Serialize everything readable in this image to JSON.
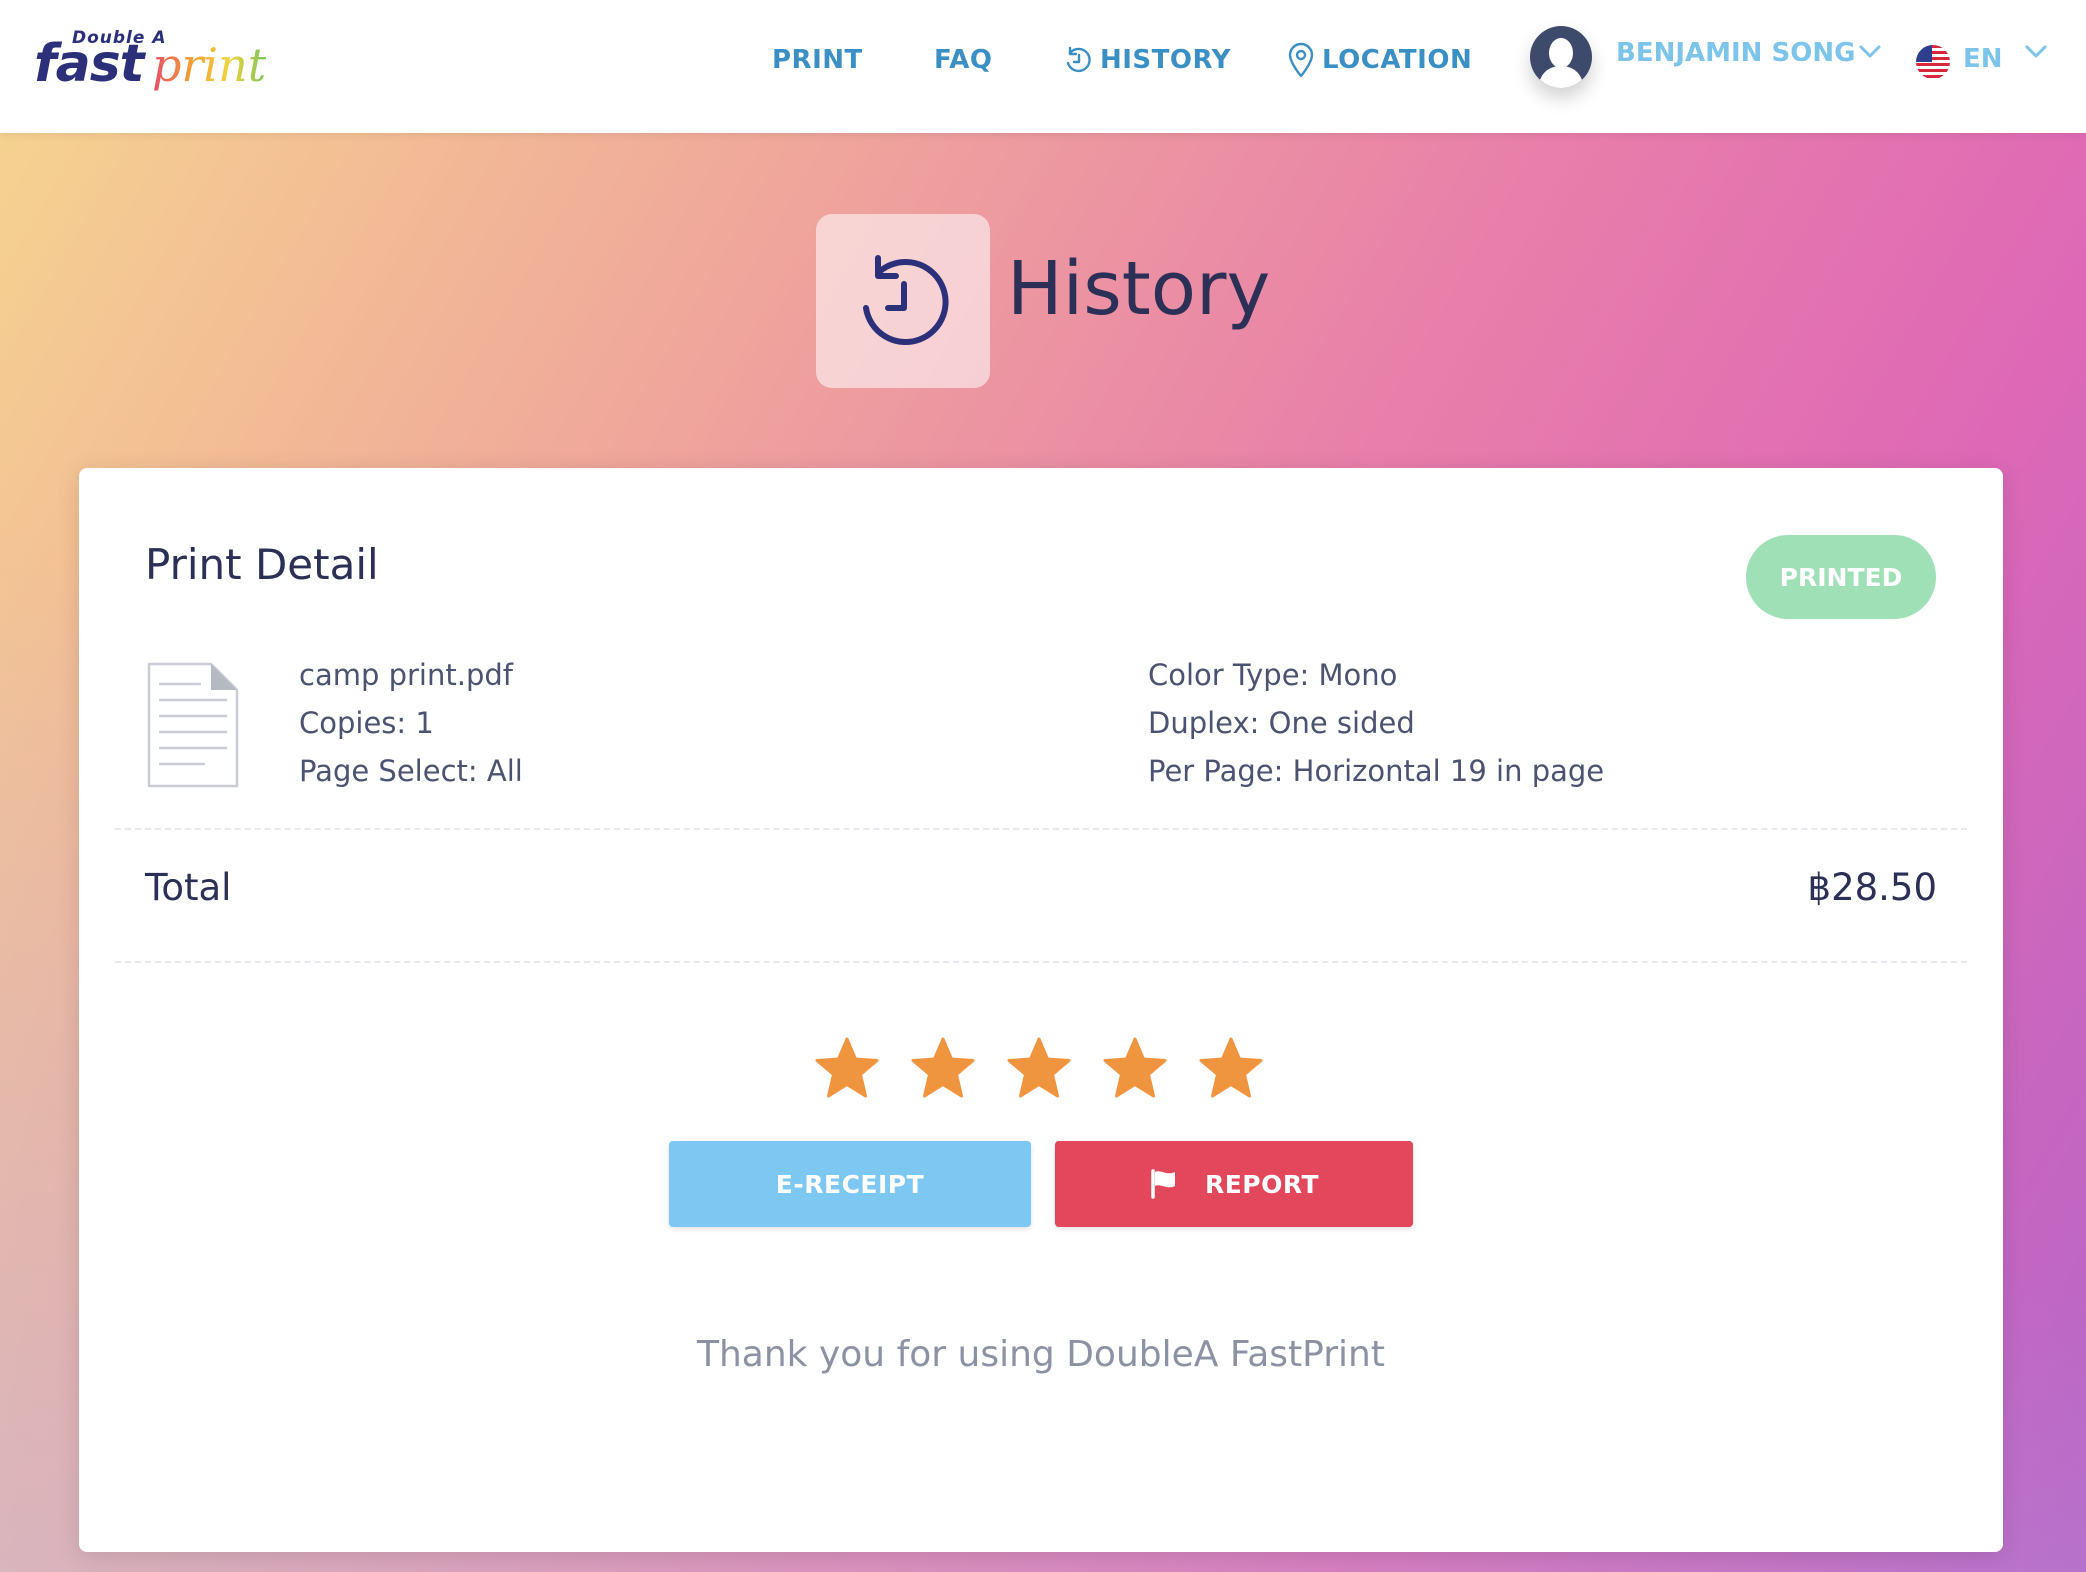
{
  "header": {
    "logo": {
      "tagline": "Double A",
      "fast": "fast",
      "print": "print"
    },
    "nav": [
      {
        "label": "PRINT"
      },
      {
        "label": "FAQ"
      },
      {
        "label": "HISTORY",
        "icon": "history-icon"
      },
      {
        "label": "LOCATION",
        "icon": "location-pin-icon"
      }
    ],
    "user": {
      "name": "BENJAMIN SONG"
    },
    "language": {
      "code": "EN",
      "flag": "us-flag-icon"
    }
  },
  "page": {
    "title": "History"
  },
  "detail": {
    "title": "Print Detail",
    "status": "PRINTED",
    "file_name": "camp print.pdf",
    "copies": "Copies: 1",
    "page_select": "Page Select: All",
    "color_type": "Color Type: Mono",
    "duplex": "Duplex: One sided",
    "per_page": "Per Page: Horizontal 19 in page",
    "total_label": "Total",
    "total_value": "฿28.50",
    "rating": 5,
    "rating_max": 5,
    "receipt_label": "E-RECEIPT",
    "report_label": "REPORT",
    "thanks": "Thank you for using DoubleA FastPrint"
  },
  "colors": {
    "nav": "#3a8fc4",
    "user": "#7cc4ea",
    "status": "#9fe0b7",
    "star": "#f0953f",
    "receipt": "#7cc8f2",
    "report": "#e2475c",
    "title": "#2c2f56"
  }
}
